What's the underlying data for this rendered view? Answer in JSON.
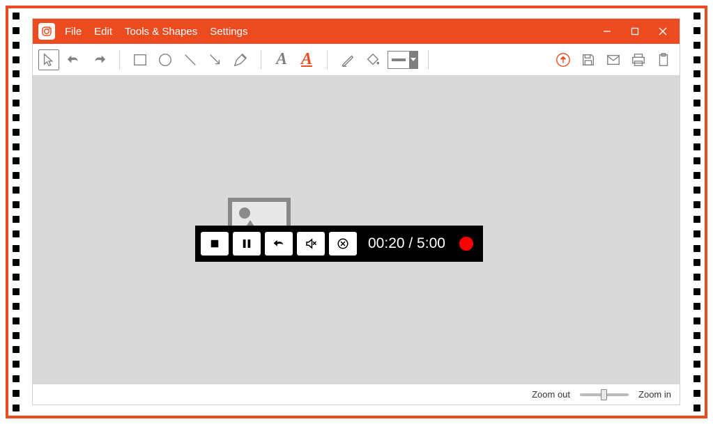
{
  "app": {
    "name": "screenshot-editor"
  },
  "menu": {
    "file": "File",
    "edit": "Edit",
    "tools": "Tools & Shapes",
    "settings": "Settings"
  },
  "toolbar": {
    "icons": {
      "cursor": "cursor-icon",
      "undo": "undo-icon",
      "redo": "redo-icon",
      "rect": "rectangle-icon",
      "circle": "circle-icon",
      "line": "line-icon",
      "arrow": "arrow-icon",
      "pen": "pen-icon",
      "textA": "A",
      "textAU": "A",
      "highlight": "highlighter-icon",
      "fill": "fill-icon",
      "lineWeight": "line-weight",
      "upload": "upload-icon",
      "save": "save-icon",
      "email": "email-icon",
      "print": "print-icon",
      "clipboard": "clipboard-icon"
    }
  },
  "recorder": {
    "buttons": {
      "stop": "stop-icon",
      "pause": "pause-icon",
      "undo": "undo-icon",
      "mute": "mute-icon",
      "cancel": "cancel-icon"
    },
    "time_elapsed": "00:20",
    "time_total": "5:00",
    "time_display": "00:20 / 5:00"
  },
  "status": {
    "zoom_out": "Zoom out",
    "zoom_in": "Zoom in"
  }
}
